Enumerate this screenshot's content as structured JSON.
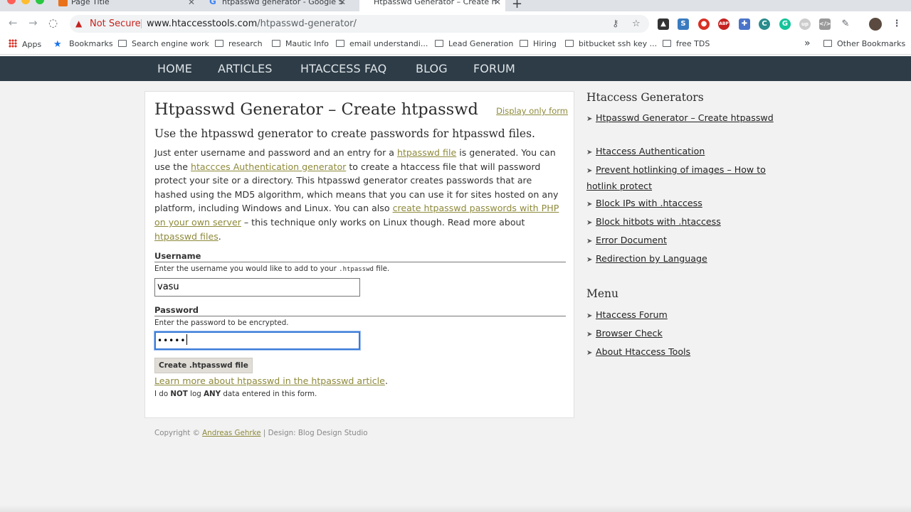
{
  "browser": {
    "tabs": [
      {
        "title": "Page Title",
        "active": false
      },
      {
        "title": "htpasswd generator - Google S",
        "active": false
      },
      {
        "title": "Htpasswd Generator – Create h",
        "active": true
      }
    ],
    "security_label": "Not Secure",
    "url_host": "www.htaccesstools.com",
    "url_path": "/htpasswd-generator/",
    "bookmarks": [
      "Apps",
      "Bookmarks",
      "Search engine work",
      "research",
      "Mautic Info",
      "email understandi...",
      "Lead Generation",
      "Hiring",
      "bitbucket ssh key ...",
      "free TDS"
    ],
    "overflow_label": "»",
    "other_bookmarks": "Other Bookmarks",
    "colors": {
      "not_secure": "#c5221f",
      "nav_bg": "#2d3c47",
      "link": "#8e8a3b",
      "focus": "#3b7bd9"
    }
  },
  "site_nav": [
    "HOME",
    "ARTICLES",
    "HTACCESS FAQ",
    "BLOG",
    "FORUM"
  ],
  "main": {
    "title": "Htpasswd Generator – Create htpasswd",
    "display_only_link": "Display only form",
    "subtitle": "Use the htpasswd generator to create passwords for htpasswd files.",
    "para": {
      "t1": "Just enter username and password and an entry for a ",
      "l1": "htpasswd file",
      "t2": " is generated. You can use the ",
      "l2": "htaccces Authentication generator",
      "t3": " to create a htaccess file that will password protect your site or a directory. This htpasswd generator creates passwords that are hashed using the MD5 algorithm, which means that you can use it for sites hosted on any platform, including Windows and Linux. You can also ",
      "l3": "create htpasswd passwords with PHP on your own server",
      "t4": " – this technique only works on Linux though. Read more about ",
      "l4": "htpasswd files",
      "t5": "."
    },
    "username": {
      "label": "Username",
      "help_pre": "Enter the username you would like to add to your ",
      "help_code": ".htpasswd",
      "help_post": " file.",
      "value": "vasu"
    },
    "password": {
      "label": "Password",
      "help": "Enter the password to be encrypted.",
      "masked_value": "•••••"
    },
    "submit_label": "Create .htpasswd file",
    "learn_link": "Learn more about htpasswd in the htpasswd article",
    "learn_end": ".",
    "nolog": {
      "t1": "I do ",
      "b1": "NOT",
      "t2": " log ",
      "b2": "ANY",
      "t3": " data entered in this form."
    }
  },
  "footer": {
    "pre": "Copyright © ",
    "author": "Andreas Gehrke",
    "post": " | Design: Blog Design Studio"
  },
  "sidebar": {
    "generators_heading": "Htaccess Generators",
    "generators": [
      "Htpasswd Generator – Create htpasswd",
      "Htaccess Authentication",
      "Prevent hotlinking of images – How to hotlink protect",
      "Block IPs with .htaccess",
      "Block hitbots with .htaccess",
      "Error Document",
      "Redirection by Language"
    ],
    "menu_heading": "Menu",
    "menu": [
      "Htaccess Forum",
      "Browser Check",
      "About Htaccess Tools"
    ]
  }
}
